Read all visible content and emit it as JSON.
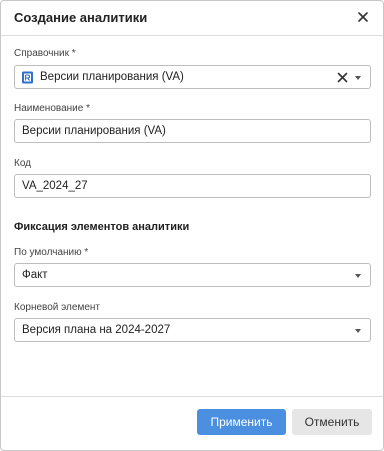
{
  "dialog": {
    "title": "Создание аналитики",
    "close_icon": "close-icon"
  },
  "form": {
    "reference": {
      "label": "Справочник *",
      "value": "Версии планирования (VA)",
      "icon": "reference-book-icon"
    },
    "name": {
      "label": "Наименование *",
      "value": "Версии планирования (VA)"
    },
    "code": {
      "label": "Код",
      "value": "VA_2024_27"
    },
    "fixation_section_title": "Фиксация элементов аналитики",
    "default": {
      "label": "По умолчанию *",
      "value": "Факт"
    },
    "root_element": {
      "label": "Корневой элемент",
      "value": "Версия плана на 2024-2027"
    }
  },
  "footer": {
    "apply_label": "Применить",
    "cancel_label": "Отменить"
  },
  "colors": {
    "primary_button": "#4a8fe0",
    "secondary_button": "#e6e6e6",
    "reference_icon": "#2f6fcf"
  }
}
